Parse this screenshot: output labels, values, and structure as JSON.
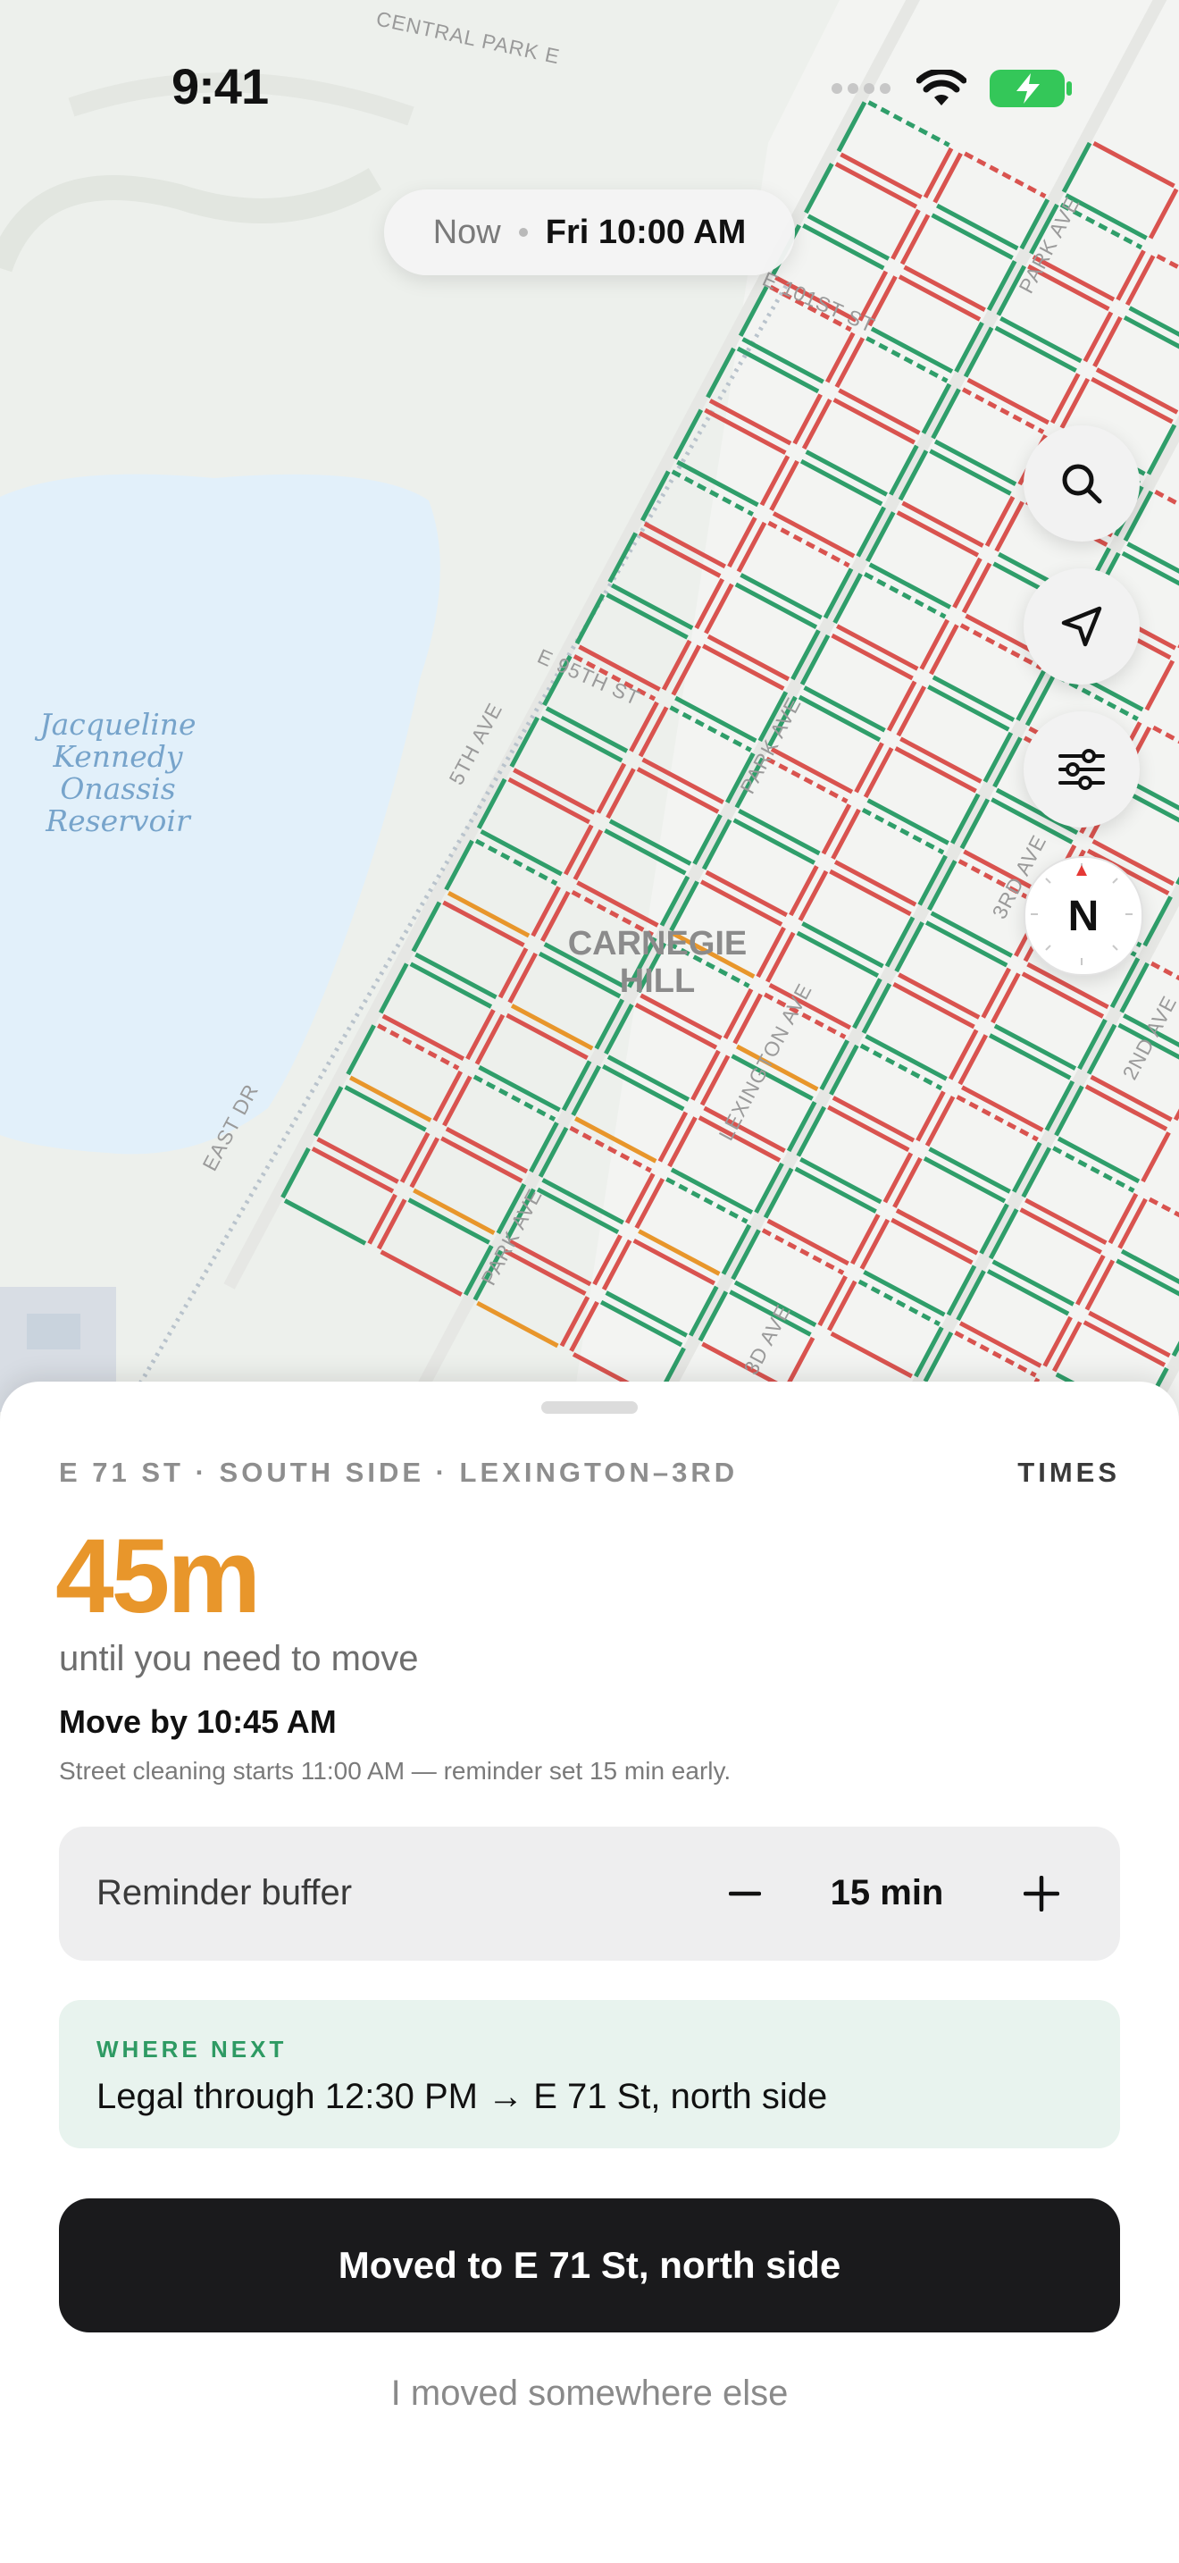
{
  "status_bar": {
    "time": "9:41"
  },
  "map": {
    "time_pill": {
      "mode": "Now",
      "time": "Fri 10:00 AM"
    },
    "labels": {
      "reservoir": [
        "Jacqueline",
        "Kennedy",
        "Onassis",
        "Reservoir"
      ],
      "neighborhood": [
        "CARNEGIE",
        "HILL"
      ],
      "streets": {
        "e101": "E 101ST ST",
        "e95": "E 95TH ST",
        "fifth_ave": "5TH AVE",
        "park_ave_1": "PARK AVE",
        "park_ave_2": "PARK AVE",
        "park_ave_3": "PARK AVE",
        "lexington": "LEXINGTON AVE",
        "third_ave": "3RD AVE",
        "second_ave": "2ND AVE",
        "east_dr": "EAST DR",
        "third_ave_2": "3D AVE",
        "central_park": "CENTRAL PARK E"
      }
    },
    "curb_colors": {
      "legal": "#2f9e6a",
      "no_parking": "#d9534f",
      "soon": "#e8962b"
    }
  },
  "map_controls": {
    "search": "search-icon",
    "locate": "location-arrow-icon",
    "filters": "sliders-icon",
    "compass": "N"
  },
  "sheet": {
    "location": "E 71 ST · SOUTH SIDE · LEXINGTON–3RD",
    "times_link": "TIMES",
    "countdown": "45m",
    "countdown_caption": "until you need to move",
    "move_by": "Move by 10:45 AM",
    "note": "Street cleaning starts 11:00 AM — reminder set 15 min early.",
    "reminder": {
      "label": "Reminder buffer",
      "value": "15 min"
    },
    "where_next": {
      "title": "WHERE NEXT",
      "text": "Legal through 12:30 PM → E 71 St, north side"
    },
    "primary_action": "Moved to E 71 St, north side",
    "secondary_action": "I moved somewhere else"
  },
  "colors": {
    "accent_orange": "#e8962b",
    "green": "#2e9a63",
    "dark": "#1a1a1c"
  }
}
